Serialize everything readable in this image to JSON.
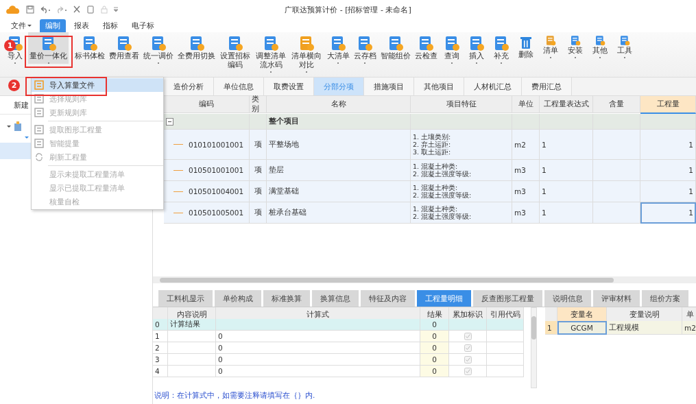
{
  "window": {
    "title": "广联达预算计价 - [招标管理 - 未命名]"
  },
  "menu_tabs": [
    {
      "label": "文件",
      "selected": false,
      "has_menu": true
    },
    {
      "label": "编制",
      "selected": true,
      "has_menu": false
    },
    {
      "label": "报表",
      "selected": false,
      "has_menu": false
    },
    {
      "label": "指标",
      "selected": false,
      "has_menu": false
    },
    {
      "label": "电子标",
      "selected": false,
      "has_menu": false
    }
  ],
  "toolbar": [
    {
      "label": "导入",
      "has_menu": true
    },
    {
      "label": "量价一体化",
      "has_menu": true
    },
    {
      "label": "标书体检",
      "has_menu": false
    },
    {
      "label": "费用查看",
      "has_menu": false
    },
    {
      "label": "统一调价",
      "has_menu": true
    },
    {
      "label": "全费用切换",
      "has_menu": false
    },
    {
      "label": "设置招标编码",
      "has_menu": false,
      "two_line": true
    },
    {
      "label": "调整清单流水码",
      "has_menu": true,
      "two_line": true
    },
    {
      "label": "清单横向对比",
      "has_menu": true,
      "two_line": true
    },
    {
      "label": "大清单",
      "has_menu": true
    },
    {
      "label": "云存档",
      "has_menu": true
    },
    {
      "label": "智能组价",
      "has_menu": false
    },
    {
      "label": "云检查",
      "has_menu": false
    },
    {
      "label": "查询",
      "has_menu": true
    },
    {
      "label": "插入",
      "has_menu": true
    },
    {
      "label": "补充",
      "has_menu": true
    },
    {
      "label": "删除",
      "has_menu": false
    },
    {
      "label": "清单",
      "has_menu": true
    },
    {
      "label": "安装",
      "has_menu": true
    },
    {
      "label": "其他",
      "has_menu": true
    },
    {
      "label": "工具",
      "has_menu": true
    }
  ],
  "step_badges": [
    {
      "label": "1"
    },
    {
      "label": "2"
    }
  ],
  "dropdown": {
    "groups": [
      [
        {
          "label": "导入算量文件",
          "disabled": false,
          "highlighted": true
        },
        {
          "label": "选择规则库",
          "disabled": true,
          "highlighted": false
        },
        {
          "label": "更新规则库",
          "disabled": true,
          "highlighted": false
        }
      ],
      [
        {
          "label": "提取图形工程量",
          "disabled": true,
          "highlighted": false
        },
        {
          "label": "智能提量",
          "disabled": true,
          "highlighted": false
        },
        {
          "label": "刷新工程量",
          "disabled": true,
          "highlighted": false
        }
      ],
      [
        {
          "label": "显示未提取工程量清单",
          "disabled": true,
          "highlighted": false
        },
        {
          "label": "显示已提取工程量清单",
          "disabled": true,
          "highlighted": false
        },
        {
          "label": "核量自检",
          "disabled": true,
          "highlighted": false
        }
      ]
    ]
  },
  "left_panel": {
    "new_label": "新建"
  },
  "doc_tabs": [
    {
      "label": "造价分析",
      "selected": false
    },
    {
      "label": "单位信息",
      "selected": false
    },
    {
      "label": "取费设置",
      "selected": false
    },
    {
      "label": "分部分项",
      "selected": true
    },
    {
      "label": "措施项目",
      "selected": false
    },
    {
      "label": "其他项目",
      "selected": false
    },
    {
      "label": "人材机汇总",
      "selected": false
    },
    {
      "label": "费用汇总",
      "selected": false
    }
  ],
  "bill_table": {
    "columns": [
      "编码",
      "类别",
      "名称",
      "项目特征",
      "单位",
      "工程量表达式",
      "含量",
      "工程量"
    ],
    "group": {
      "name": "整个项目",
      "expanded": true
    },
    "rows": [
      {
        "code": "010101001001",
        "type": "项",
        "name": "平整场地",
        "features": [
          "1. 土壤类别:",
          "2. 弃土运距:",
          "3. 取土运距:"
        ],
        "unit": "m2",
        "expression": "1",
        "quantity": "1",
        "selected": false
      },
      {
        "code": "010501001001",
        "type": "项",
        "name": "垫层",
        "features": [
          "1. 混凝土种类:",
          "2. 混凝土强度等级:"
        ],
        "unit": "m3",
        "expression": "1",
        "quantity": "1",
        "selected": false
      },
      {
        "code": "010501004001",
        "type": "项",
        "name": "满堂基础",
        "features": [
          "1. 混凝土种类:",
          "2. 混凝土强度等级:"
        ],
        "unit": "m3",
        "expression": "1",
        "quantity": "1",
        "selected": false
      },
      {
        "code": "010501005001",
        "type": "项",
        "name": "桩承台基础",
        "features": [
          "1. 混凝土种类:",
          "2. 混凝土强度等级:"
        ],
        "unit": "m3",
        "expression": "1",
        "quantity": "1",
        "selected": true
      }
    ]
  },
  "detail_tabs": [
    {
      "label": "工料机显示",
      "selected": false
    },
    {
      "label": "单价构成",
      "selected": false
    },
    {
      "label": "标准换算",
      "selected": false
    },
    {
      "label": "换算信息",
      "selected": false
    },
    {
      "label": "特征及内容",
      "selected": false
    },
    {
      "label": "工程量明细",
      "selected": true
    },
    {
      "label": "反查图形工程量",
      "selected": false
    },
    {
      "label": "说明信息",
      "selected": false
    },
    {
      "label": "评审材料",
      "selected": false
    },
    {
      "label": "组价方案",
      "selected": false
    }
  ],
  "detail_table": {
    "columns": [
      "内容说明",
      "计算式",
      "结果",
      "累加标识",
      "引用代码"
    ],
    "rows": [
      {
        "index": "0",
        "description": "计算结果",
        "formula": "",
        "result": "0",
        "accumulate": false,
        "selected": true
      },
      {
        "index": "1",
        "description": "",
        "formula": "0",
        "result": "0",
        "accumulate": true,
        "selected": false
      },
      {
        "index": "2",
        "description": "",
        "formula": "0",
        "result": "0",
        "accumulate": true,
        "selected": false
      },
      {
        "index": "3",
        "description": "",
        "formula": "0",
        "result": "0",
        "accumulate": true,
        "selected": false
      },
      {
        "index": "4",
        "description": "",
        "formula": "0",
        "result": "0",
        "accumulate": true,
        "selected": false
      }
    ]
  },
  "variable_table": {
    "columns": [
      "变量名",
      "变量说明",
      "单"
    ],
    "rows": [
      {
        "index": "1",
        "name": "GCGM",
        "description": "工程规模",
        "unit": "m2",
        "selected": true
      }
    ]
  },
  "note": "说明：在计算式中，如需要注释请填写在｛｝内."
}
